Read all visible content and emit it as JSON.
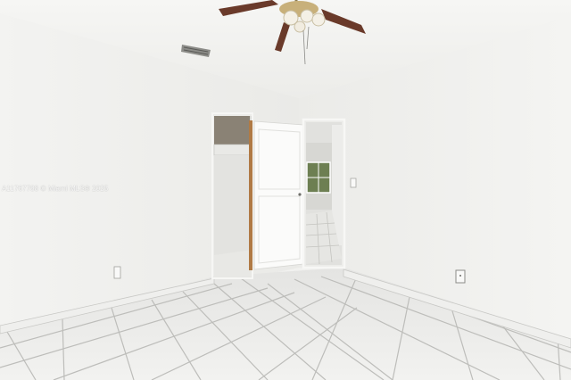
{
  "watermark": {
    "text": "A11767788 © Miami MLS® 2025"
  },
  "colors": {
    "wall": "#f2f2f0",
    "ceiling": "#f4f4f2",
    "floor": "#e9e9e7",
    "grout": "#b9b9b6",
    "fan_blade": "#6a3a2a",
    "door": "#fafafa",
    "door_frame": "#b07a45"
  },
  "icons": [
    "ceiling-fan-icon",
    "air-vent-icon",
    "light-switch-icon",
    "power-outlet-icon"
  ]
}
